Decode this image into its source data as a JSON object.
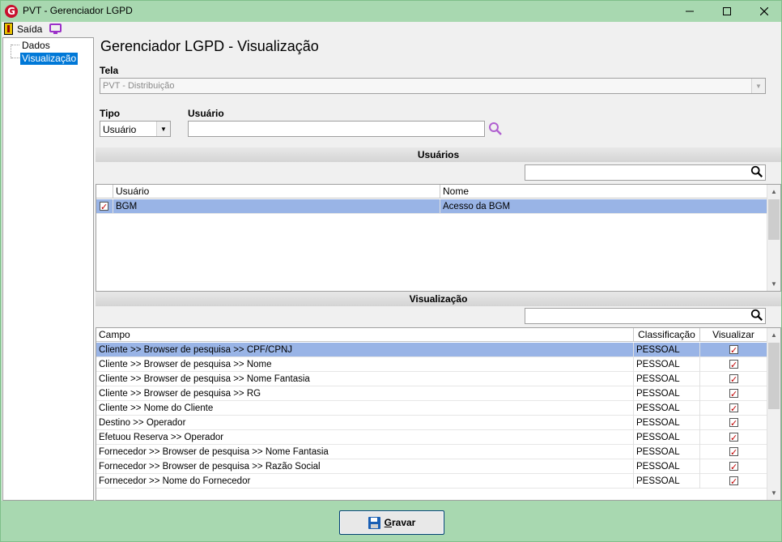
{
  "window": {
    "title": "PVT - Gerenciador LGPD",
    "app_icon_letter": "G"
  },
  "toolbar": {
    "exit_label": "Saída"
  },
  "tree": {
    "items": [
      {
        "label": "Dados"
      },
      {
        "label": "Visualização"
      }
    ]
  },
  "header": {
    "title": "Gerenciador LGPD - Visualização"
  },
  "tela": {
    "label": "Tela",
    "value": "PVT - Distribuição"
  },
  "tipo": {
    "label": "Tipo",
    "value": "Usuário"
  },
  "usuario_field": {
    "label": "Usuário",
    "value": ""
  },
  "usuarios_section": {
    "title": "Usuários",
    "search_value": "",
    "columns": [
      "Usuário",
      "Nome"
    ],
    "rows": [
      {
        "checked": true,
        "usuario": "BGM",
        "nome": "Acesso da BGM"
      }
    ]
  },
  "visualizacao_section": {
    "title": "Visualização",
    "search_value": "",
    "columns": [
      "Campo",
      "Classificação",
      "Visualizar"
    ],
    "rows": [
      {
        "campo": "Cliente >> Browser de pesquisa >> CPF/CPNJ",
        "classificacao": "PESSOAL",
        "visualizar": true
      },
      {
        "campo": "Cliente >> Browser de pesquisa >> Nome",
        "classificacao": "PESSOAL",
        "visualizar": true
      },
      {
        "campo": "Cliente >> Browser de pesquisa >> Nome Fantasia",
        "classificacao": "PESSOAL",
        "visualizar": true
      },
      {
        "campo": "Cliente >> Browser de pesquisa >> RG",
        "classificacao": "PESSOAL",
        "visualizar": true
      },
      {
        "campo": "Cliente >> Nome do Cliente",
        "classificacao": "PESSOAL",
        "visualizar": true
      },
      {
        "campo": "Destino >> Operador",
        "classificacao": "PESSOAL",
        "visualizar": true
      },
      {
        "campo": "Efetuou Reserva >> Operador",
        "classificacao": "PESSOAL",
        "visualizar": true
      },
      {
        "campo": "Fornecedor >> Browser de pesquisa >> Nome Fantasia",
        "classificacao": "PESSOAL",
        "visualizar": true
      },
      {
        "campo": "Fornecedor >> Browser de pesquisa >> Razão Social",
        "classificacao": "PESSOAL",
        "visualizar": true
      },
      {
        "campo": "Fornecedor >> Nome do Fornecedor",
        "classificacao": "PESSOAL",
        "visualizar": true
      }
    ]
  },
  "footer": {
    "save_label_first": "G",
    "save_label_rest": "ravar"
  },
  "colors": {
    "titlebar": "#a8d8b0",
    "selection": "#99b4e6",
    "tree_selection": "#0078d7",
    "check": "#c00000"
  }
}
